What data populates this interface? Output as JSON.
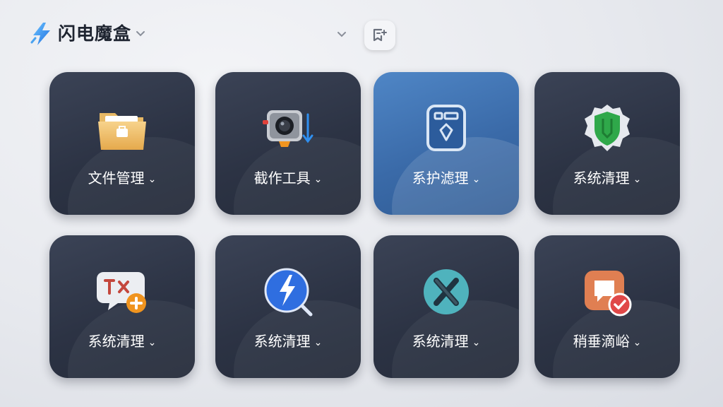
{
  "header": {
    "title": "闪电魔盒",
    "logo_icon": "lightning-bolt-icon",
    "action_icon": "edit-screen-icon"
  },
  "tiles": [
    {
      "label": "文件管理",
      "icon": "folder-icon"
    },
    {
      "label": "截作工具",
      "icon": "camera-icon"
    },
    {
      "label": "系护滤理",
      "icon": "device-panel-icon"
    },
    {
      "label": "系统清理",
      "icon": "shield-icon"
    },
    {
      "label": "系统清理",
      "icon": "text-add-icon"
    },
    {
      "label": "系统清理",
      "icon": "search-bolt-icon"
    },
    {
      "label": "系统清理",
      "icon": "tools-icon"
    },
    {
      "label": "稍垂滴峪",
      "icon": "chat-check-icon"
    }
  ],
  "chevron": "⌄",
  "colors": {
    "accent": "#3a6aa8",
    "tile_dark": "#2c3344",
    "title_text": "#1e2430"
  }
}
